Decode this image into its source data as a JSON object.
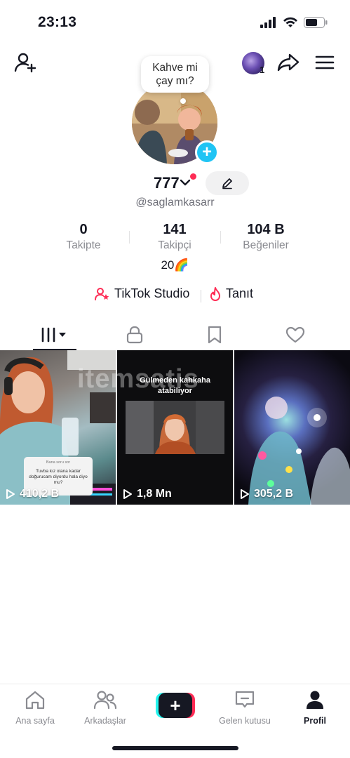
{
  "status_bar": {
    "time": "23:13"
  },
  "profile": {
    "note": "Kahve mi\nçay mı?",
    "notification_count": "1",
    "display_name": "777",
    "username": "@saglamkasarr",
    "bio": "20🌈"
  },
  "stats": [
    {
      "value": "0",
      "label": "Takipte"
    },
    {
      "value": "141",
      "label": "Takipçi"
    },
    {
      "value": "104 B",
      "label": "Beğeniler"
    }
  ],
  "links": [
    {
      "label": "TikTok Studio",
      "icon": "studio-person-star-icon"
    },
    {
      "label": "Tanıt",
      "icon": "flame-icon"
    }
  ],
  "tabs": [
    "videos-grid-icon",
    "lock-icon",
    "bookmark-icon",
    "heart-icon"
  ],
  "videos": [
    {
      "views": "410,2 B",
      "question_header": "Bana soru sor",
      "question_text": "Tuvba kız olana kadar doğurucam diyordu hala diyo mu?"
    },
    {
      "views": "1,8 Mn",
      "caption": "Gülmeden kahkaha\natabiliyor"
    },
    {
      "views": "305,2 B"
    }
  ],
  "watermark": "itemsatis",
  "bottom_nav": [
    {
      "label": "Ana sayfa",
      "icon": "home-icon"
    },
    {
      "label": "Arkadaşlar",
      "icon": "friends-icon"
    },
    {
      "label": "",
      "icon": "create-plus-icon"
    },
    {
      "label": "Gelen kutusu",
      "icon": "inbox-icon"
    },
    {
      "label": "Profil",
      "icon": "profile-icon",
      "active": true
    }
  ],
  "colors": {
    "accent_red": "#fe2c55",
    "accent_cyan": "#25f4ee",
    "plus_blue": "#20c4f4",
    "text_primary": "#161823",
    "text_secondary": "#8a8b91"
  }
}
